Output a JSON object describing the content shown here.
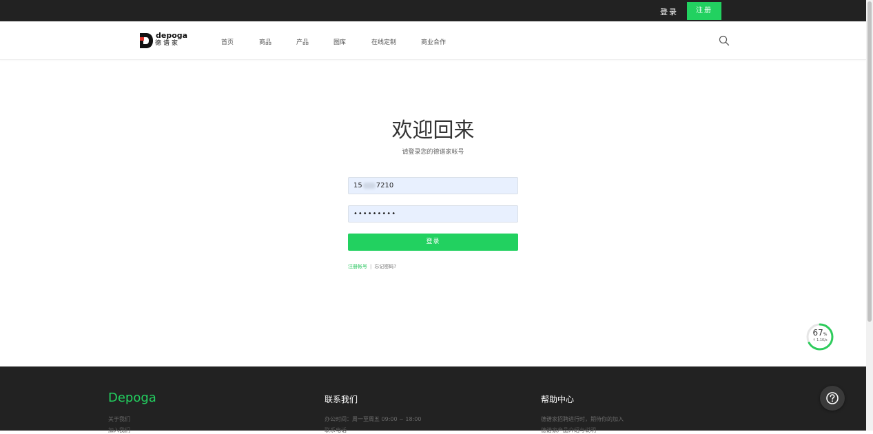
{
  "topbar": {
    "login_label": "登录",
    "register_label": "注册"
  },
  "brand": {
    "logo_text": "depoga",
    "logo_cn": "德谱家"
  },
  "nav": {
    "items": [
      "首页",
      "商品",
      "产品",
      "图库",
      "在线定制",
      "商业合作"
    ]
  },
  "icons": {
    "search": "search-icon",
    "help": "help-icon",
    "logo": "depoga-logo-icon"
  },
  "login": {
    "title": "欢迎回来",
    "subtitle": "请登录您的德谱家帐号",
    "phone_prefix": "15",
    "phone_suffix": "7210",
    "password_mask": "•••••••••",
    "submit_label": "登录",
    "register_link": "注册帐号",
    "separator": "|",
    "forgot_link": "忘记密码?"
  },
  "speed_widget": {
    "percent": "67",
    "unit": "%",
    "rate": "↑ 1.1K/s",
    "progress_fraction": 0.67
  },
  "footer": {
    "brand": "Depoga",
    "col1": {
      "item1": "关于我们",
      "item2": "加入我们"
    },
    "col2": {
      "heading": "联系我们",
      "item1": "办公时间：周一至周五 09:00 ~ 18:00",
      "item2": "联系电话"
    },
    "col3": {
      "heading": "帮助中心",
      "item1": "德谱家招聘进行时，期待你的加入",
      "item2": "德谱家产品介绍与说明"
    }
  },
  "colors": {
    "accent": "#22d160",
    "dark": "#222222",
    "input_bg": "#e8f0fe"
  }
}
